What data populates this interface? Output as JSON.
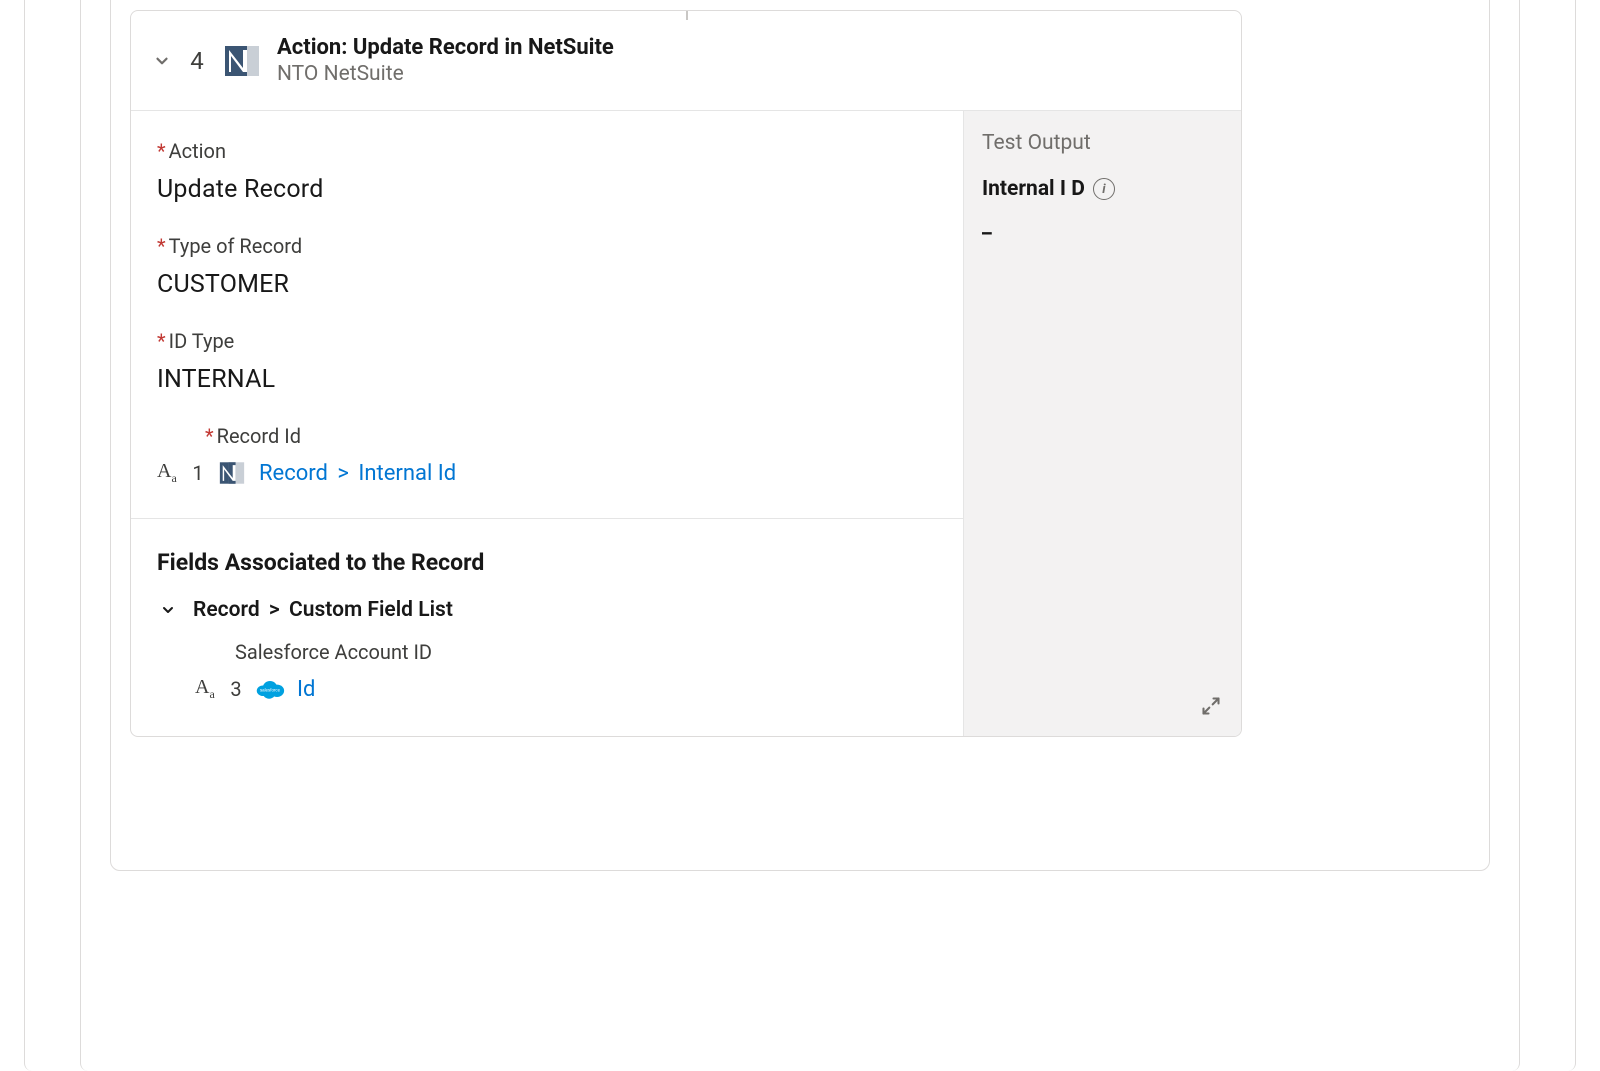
{
  "header": {
    "step_number": "4",
    "title": "Action: Update Record in NetSuite",
    "subtitle": "NTO NetSuite"
  },
  "fields": {
    "action": {
      "label": "Action",
      "value": "Update Record"
    },
    "type_of_record": {
      "label": "Type of Record",
      "value": "CUSTOMER"
    },
    "id_type": {
      "label": "ID Type",
      "value": "INTERNAL"
    },
    "record_id": {
      "label": "Record Id",
      "ref_step": "1",
      "ref_path_a": "Record",
      "ref_sep": ">",
      "ref_path_b": "Internal Id"
    }
  },
  "associated": {
    "heading": "Fields Associated to the Record",
    "group_path_a": "Record",
    "group_sep": ">",
    "group_path_b": "Custom Field List",
    "sf_account": {
      "label": "Salesforce Account ID",
      "ref_step": "3",
      "ref_field": "Id"
    }
  },
  "test_output": {
    "title": "Test Output",
    "field_label": "Internal I D",
    "value": "_"
  }
}
